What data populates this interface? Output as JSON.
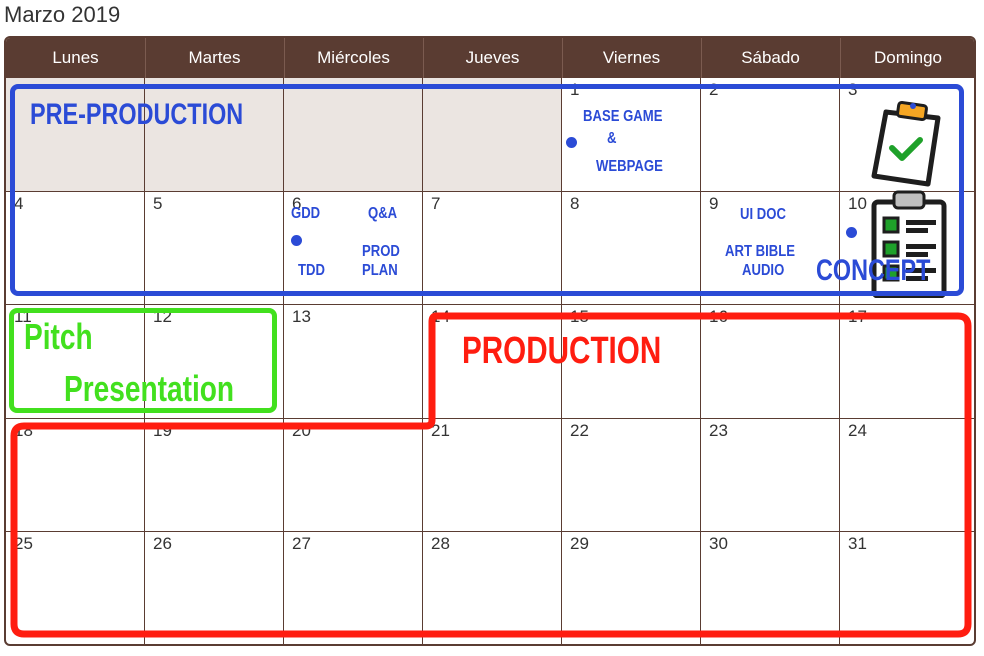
{
  "month_title": "Marzo 2019",
  "weekdays": [
    "Lunes",
    "Martes",
    "Miércoles",
    "Jueves",
    "Viernes",
    "Sábado",
    "Domingo"
  ],
  "weeks": [
    [
      "",
      "",
      "",
      "",
      "1",
      "2",
      "3"
    ],
    [
      "4",
      "5",
      "6",
      "7",
      "8",
      "9",
      "10"
    ],
    [
      "11",
      "12",
      "13",
      "14",
      "15",
      "16",
      "17"
    ],
    [
      "18",
      "19",
      "20",
      "21",
      "22",
      "23",
      "24"
    ],
    [
      "25",
      "26",
      "27",
      "28",
      "29",
      "30",
      "31"
    ]
  ],
  "events": {
    "base_game_1": "BASE GAME",
    "base_game_2": "&",
    "base_game_3": "WEBPAGE",
    "gdd": "GDD",
    "tdd": "TDD",
    "qa": "Q&A",
    "prod_plan_1": "PROD",
    "prod_plan_2": "PLAN",
    "ui_doc": "UI DOC",
    "art_bible": "ART BIBLE",
    "audio": "AUDIO"
  },
  "phases": {
    "pre_production": "PRE-PRODUCTION",
    "concept": "CONCEPT",
    "pitch_1": "Pitch",
    "pitch_2": "Presentation",
    "production": "PRODUCTION"
  },
  "colors": {
    "header_bg": "#5a3c32",
    "pre_production": "#2b4bd6",
    "pitch": "#42e01e",
    "production": "#ff1d10"
  },
  "icons": [
    "clipboard-check-icon",
    "clipboard-checklist-icon"
  ]
}
